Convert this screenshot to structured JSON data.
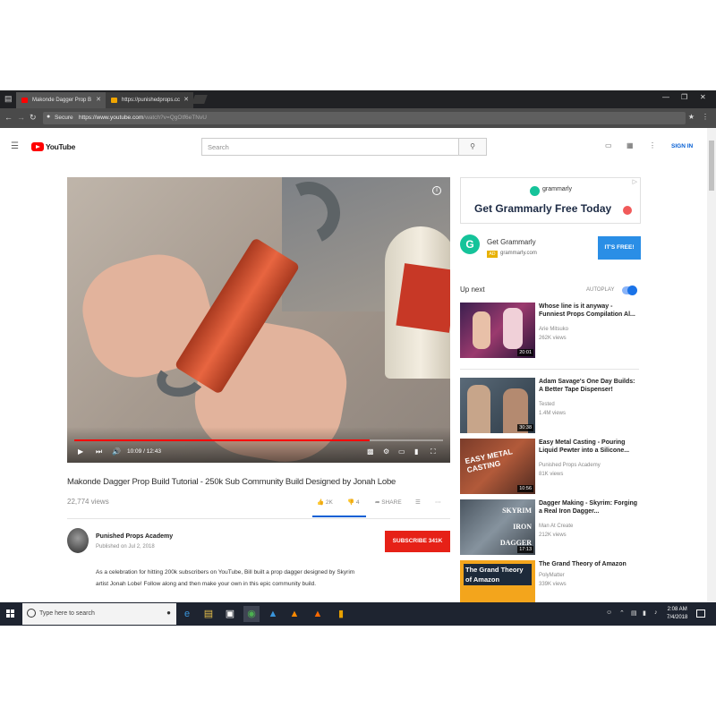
{
  "browser": {
    "tabs": [
      {
        "label": "Makonde Dagger Prop B",
        "favicon_color": "#ff0000"
      },
      {
        "label": "https://punishedprops.cc",
        "favicon_color": "#f0a500"
      }
    ],
    "secure_label": "Secure",
    "url_host": "https://www.youtube.com",
    "url_path": "/watch?v=QgOtf6eTNvU"
  },
  "youtube": {
    "logo_text": "YouTube",
    "search_placeholder": "Search",
    "signin_label": "SIGN IN"
  },
  "video": {
    "current_time": "10:09 / 12:43",
    "progress": 0.8,
    "title": "Makonde Dagger Prop Build Tutorial - 250k Sub Community Build Designed by Jonah Lobe",
    "views": "22,774 views",
    "likes": "2K",
    "dislikes": "4",
    "share_label": "SHARE"
  },
  "channel": {
    "name": "Punished Props Academy",
    "published": "Published on Jul 2, 2018",
    "subscribe_label": "SUBSCRIBE 341K"
  },
  "description": "As a celebration for hitting 200k subscribers on YouTube, Bill built a prop dagger designed by Skyrim artist Jonah Lobe! Follow along and then make your own in this epic community build.",
  "ad": {
    "brand": "grammarly",
    "headline": "Get Grammarly Free Today",
    "advertiser": "Get Grammarly",
    "badge": "AD",
    "domain": "grammarly.com",
    "cta": "IT'S FREE!"
  },
  "sidebar": {
    "upnext_label": "Up next",
    "autoplay_label": "AUTOPLAY",
    "recommendations": [
      {
        "title": "Whose line is it anyway - Funniest Props Compilation Al...",
        "channel": "Arie Mitsuko",
        "views": "262K views",
        "duration": "20:01"
      },
      {
        "title": "Adam Savage's One Day Builds: A Better Tape Dispenser!",
        "channel": "Tested",
        "views": "1.4M views",
        "duration": "30:38"
      },
      {
        "title": "Easy Metal Casting - Pouring Liquid Pewter into a Silicone...",
        "channel": "Punished Props Academy",
        "views": "81K views",
        "duration": "10:56",
        "thumb_text": "EASY METAL CASTING"
      },
      {
        "title": "Dagger Making - Skyrim: Forging a Real Iron Dagger...",
        "channel": "Man At Create",
        "views": "212K views",
        "duration": "17:13",
        "thumb_text": "SKYRIM IRON DAGGER"
      },
      {
        "title": "The Grand Theory of Amazon",
        "channel": "PolyMatter",
        "views": "339K views",
        "duration": "",
        "thumb_text": "The Grand Theory of Amazon"
      }
    ]
  },
  "taskbar": {
    "search_placeholder": "Type here to search",
    "time": "2:08 AM",
    "date": "7/4/2018"
  },
  "colors": {
    "youtube_red": "#ff0000",
    "subscribe_red": "#e62117",
    "link_blue": "#065fd4",
    "grammarly_green": "#15c39a"
  }
}
